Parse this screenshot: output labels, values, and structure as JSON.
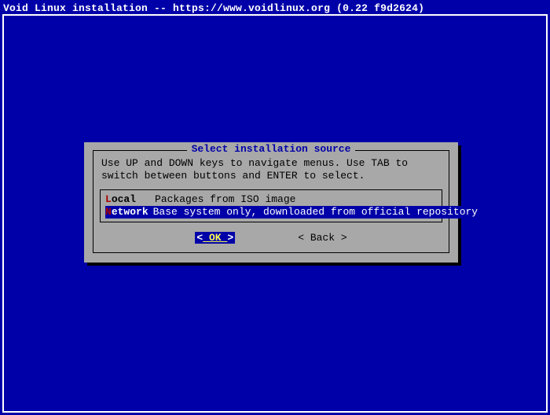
{
  "colors": {
    "background": "#0000a8",
    "panel": "#a8a8a8",
    "highlight_bg": "#0000a8",
    "highlight_fg": "#ffffff",
    "accent_red": "#a80000",
    "accent_yellow": "#ffff55",
    "border_white": "#ffffff",
    "border_black": "#000000"
  },
  "header": {
    "title": "Void Linux installation -- https://www.voidlinux.org (0.22 f9d2624)"
  },
  "dialog": {
    "title": "Select installation source",
    "help_text": "Use UP and DOWN keys to navigate menus. Use TAB to switch between buttons and ENTER to select.",
    "options": [
      {
        "key": "L",
        "rest": "ocal",
        "description": "Packages from ISO image",
        "selected": false
      },
      {
        "key": "N",
        "rest": "etwork",
        "description": "Base system only, downloaded from official repository",
        "selected": true
      }
    ],
    "buttons": {
      "ok": {
        "bracket_left": "<",
        "label": " OK ",
        "bracket_right": ">"
      },
      "back": {
        "bracket_left": "<",
        "label": " Back ",
        "bracket_right": ">"
      }
    }
  }
}
